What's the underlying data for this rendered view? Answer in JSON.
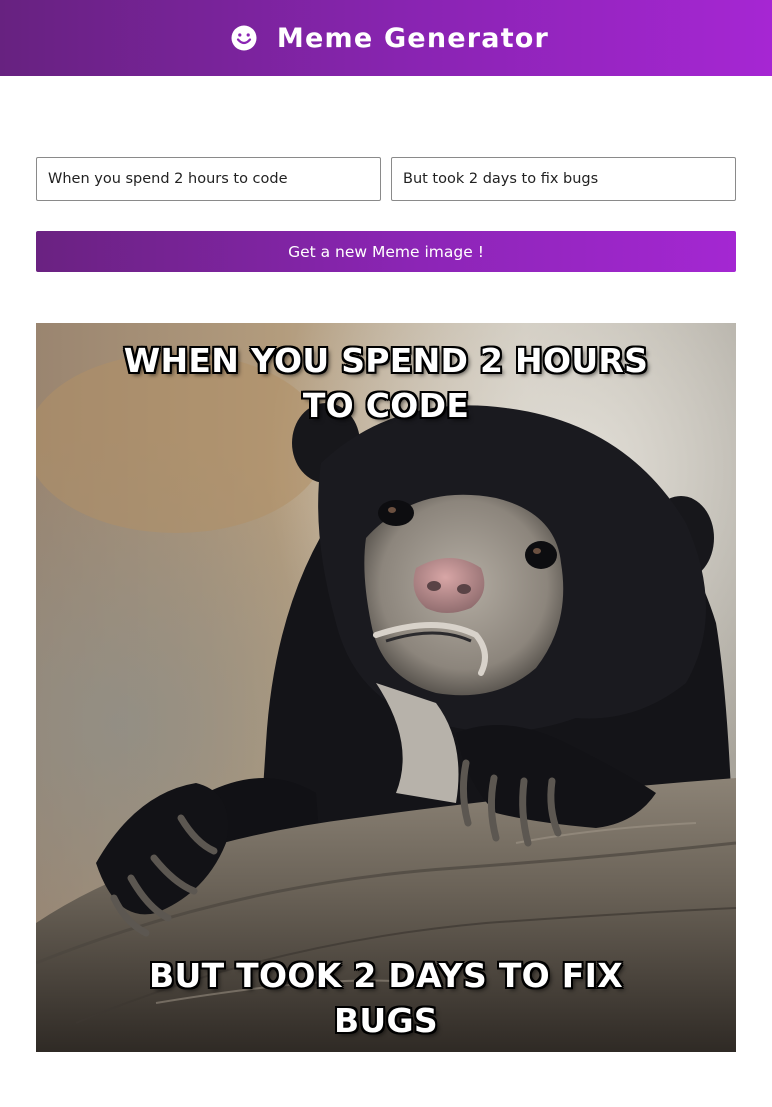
{
  "header": {
    "logo_icon": "smiling-face-icon",
    "title": "Meme Generator",
    "gradient": [
      "#672280",
      "#a626d3"
    ]
  },
  "form": {
    "top_text_value": "When you spend 2 hours to code",
    "bottom_text_value": "But took 2 days to fix bugs",
    "button_label": "Get a new Meme image !"
  },
  "meme": {
    "image_subject": "confession-bear",
    "top_text": "When you spend 2 hours to code",
    "bottom_text": "But took 2 days to fix bugs"
  },
  "colors": {
    "accent_start": "#6a2281",
    "accent_end": "#a427d2",
    "text_on_accent": "#ffffff"
  }
}
